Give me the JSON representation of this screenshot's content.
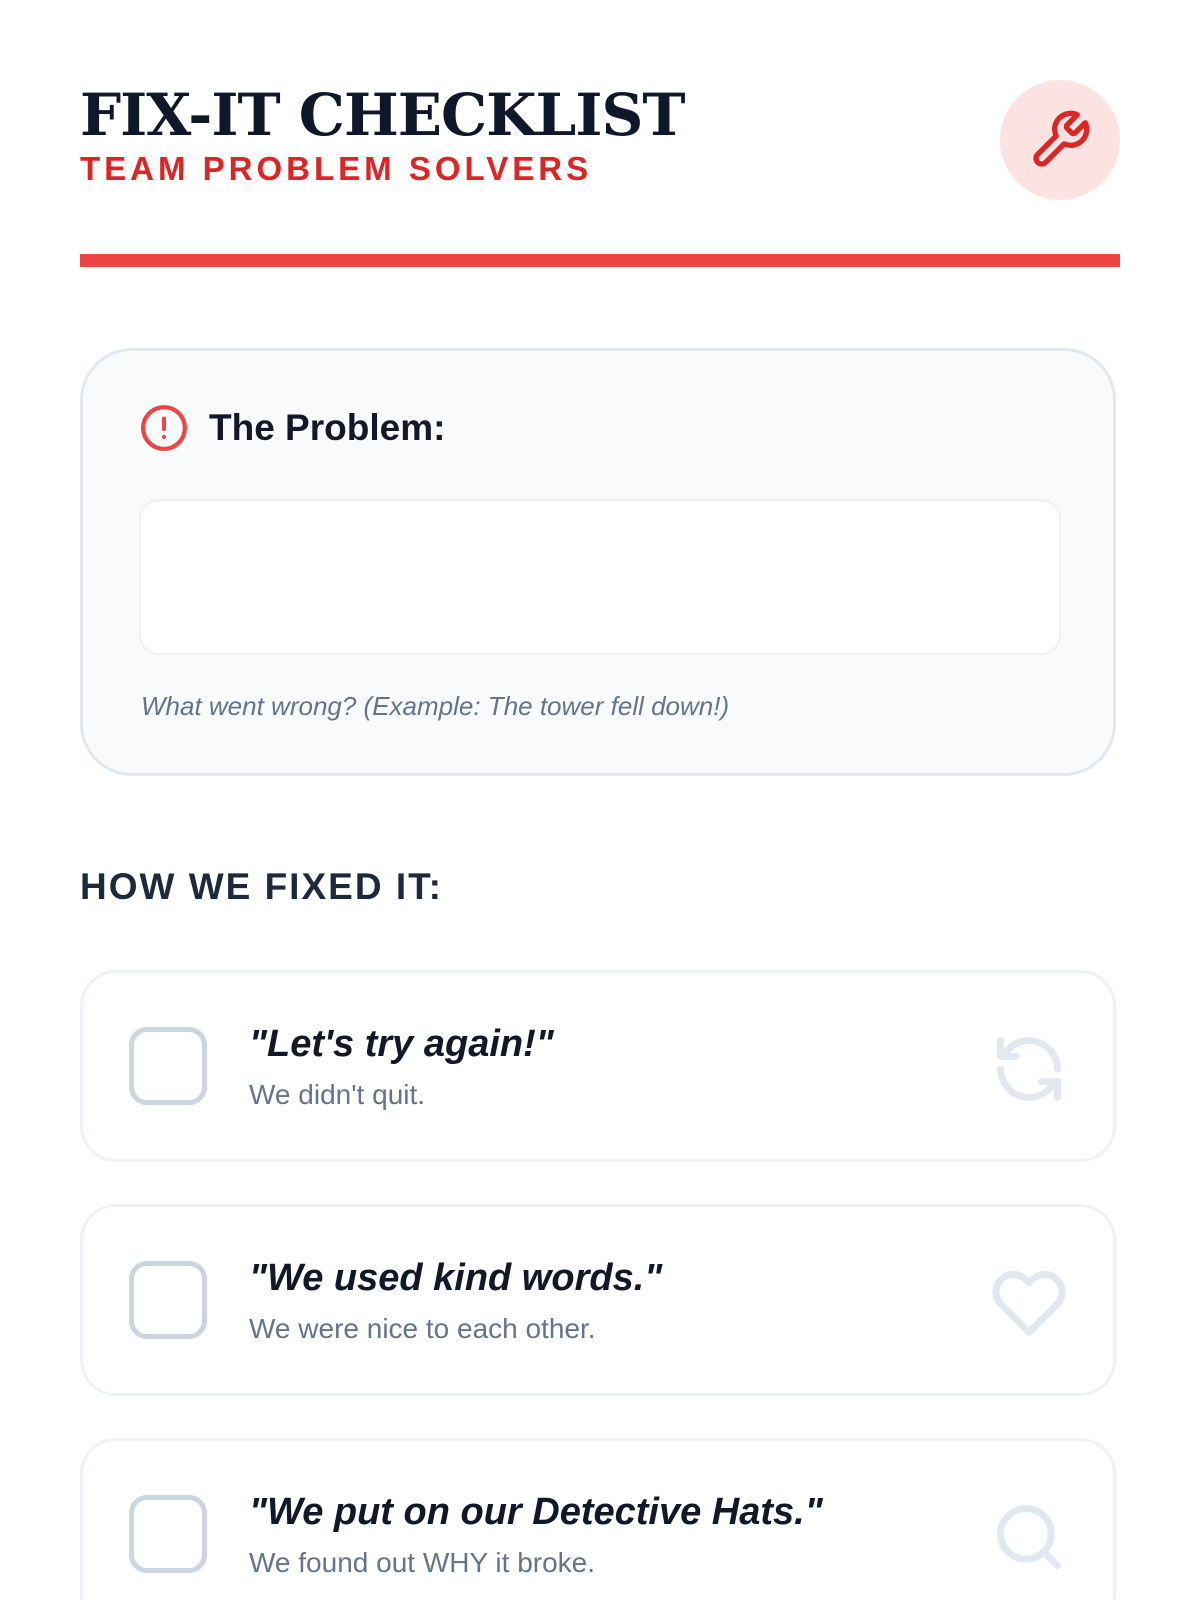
{
  "header": {
    "title": "FIX-IT CHECKLIST",
    "subtitle": "TEAM PROBLEM SOLVERS",
    "badge_icon": "wrench-icon"
  },
  "colors": {
    "accent": "#ef4444",
    "accent_dark": "#dc2626",
    "badge_bg": "#fde2e2",
    "text_dark": "#0f172a",
    "text_muted": "#64748b",
    "border_light": "#e2e8f0"
  },
  "problem": {
    "icon": "alert-circle-icon",
    "title": "The Problem:",
    "input_value": "",
    "hint": "What went wrong? (Example: The tower fell down!)"
  },
  "section": {
    "title": "HOW WE FIXED IT:"
  },
  "checklist": {
    "items": [
      {
        "title": "\"Let's try again!\"",
        "description": "We didn't quit.",
        "icon": "refresh-icon",
        "checked": false
      },
      {
        "title": "\"We used kind words.\"",
        "description": "We were nice to each other.",
        "icon": "heart-icon",
        "checked": false
      },
      {
        "title": "\"We put on our Detective Hats.\"",
        "description": "We found out WHY it broke.",
        "icon": "search-icon",
        "checked": false
      }
    ]
  }
}
